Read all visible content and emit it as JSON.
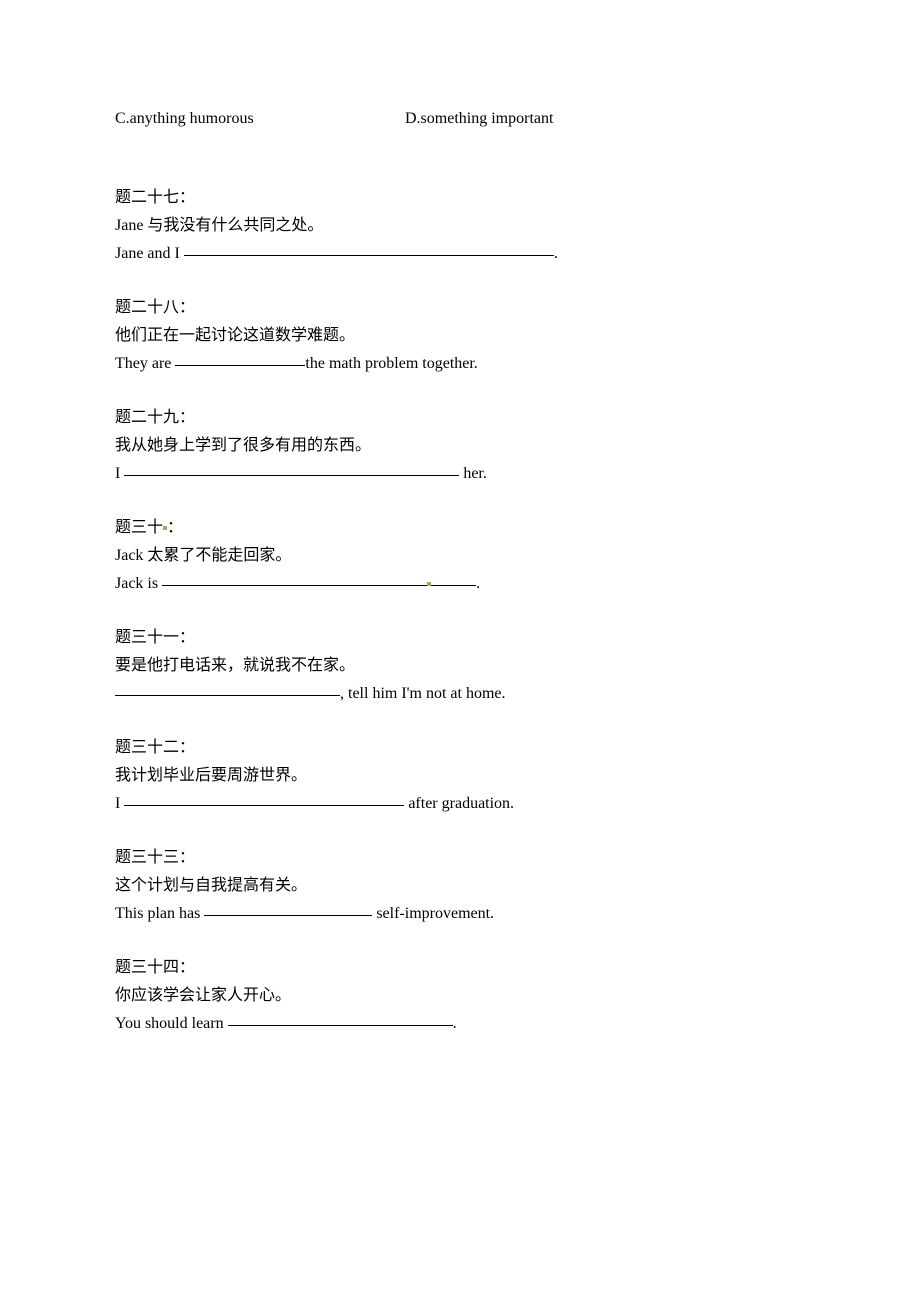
{
  "options": {
    "c": "C.anything humorous",
    "d": "D.something important"
  },
  "questions": {
    "q27": {
      "title": "题二十七：",
      "chinese": "Jane 与我没有什么共同之处。",
      "english_pre": "Jane and I ",
      "english_post": "."
    },
    "q28": {
      "title": "题二十八：",
      "chinese": "他们正在一起讨论这道数学难题。",
      "english_pre": "They are ",
      "english_post": "the math problem together."
    },
    "q29": {
      "title": "题二十九：",
      "chinese": "我从她身上学到了很多有用的东西。",
      "english_pre": "I ",
      "english_post": " her."
    },
    "q30": {
      "title": "题三十",
      "title_suffix": "：",
      "chinese": "Jack  太累了不能走回家。",
      "english_pre": "Jack is ",
      "english_post": "."
    },
    "q31": {
      "title": "题三十一：",
      "chinese": "要是他打电话来，就说我不在家。",
      "english_pre": "",
      "english_post": ", tell him I'm not at home."
    },
    "q32": {
      "title": "题三十二：",
      "chinese": "我计划毕业后要周游世界。",
      "english_pre": "I ",
      "english_post": " after graduation."
    },
    "q33": {
      "title": "题三十三：",
      "chinese": "这个计划与自我提高有关。",
      "english_pre": "This plan has ",
      "english_post": " self-improvement."
    },
    "q34": {
      "title": "题三十四：",
      "chinese": "你应该学会让家人开心。",
      "english_pre": "You should learn ",
      "english_post": "."
    }
  }
}
